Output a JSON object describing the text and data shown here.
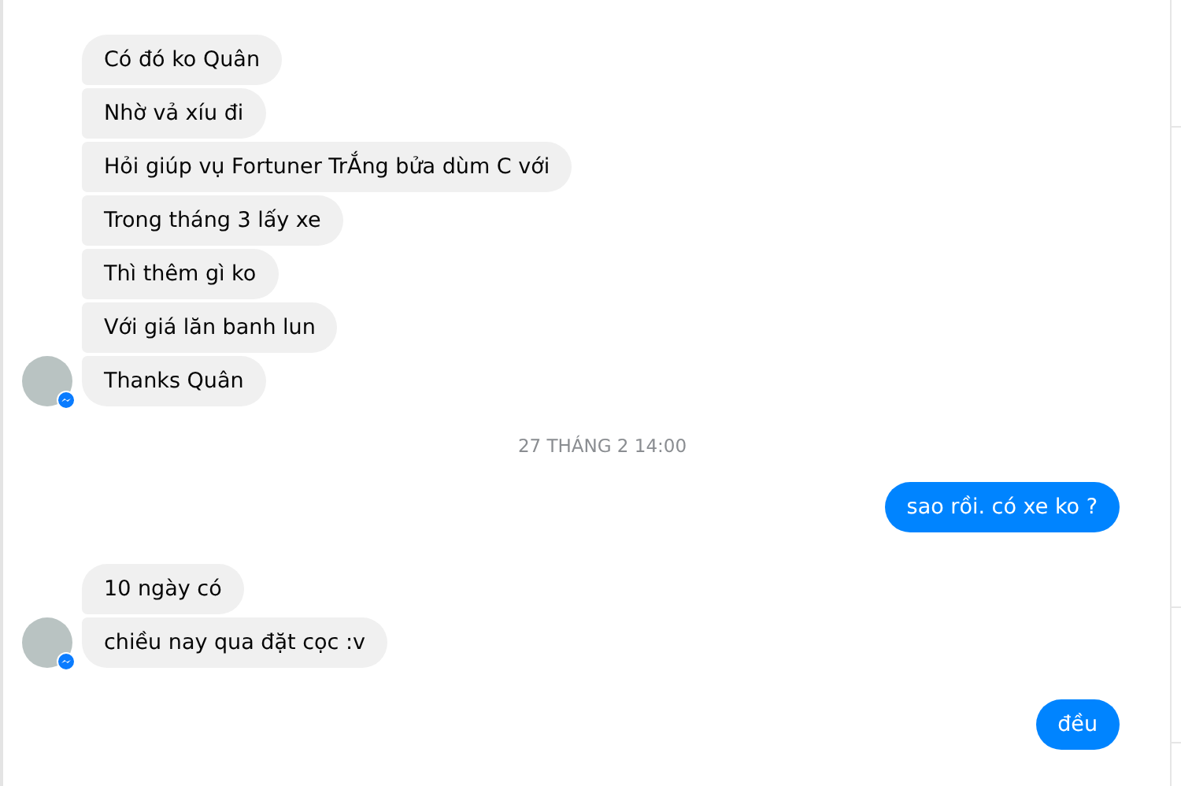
{
  "thread": [
    {
      "kind": "received",
      "messages": [
        "Có đó ko Quân",
        "Nhờ vả xíu đi",
        "Hỏi giúp vụ Fortuner TrẮng bửa dùm C với",
        "Trong tháng 3 lấy xe",
        "Thì thêm gì ko",
        "Với giá lăn banh lun",
        "Thanks Quân"
      ]
    },
    {
      "kind": "timestamp",
      "text": "27 THÁNG 2 14:00"
    },
    {
      "kind": "sent",
      "messages": [
        "sao rồi. có xe ko ?"
      ]
    },
    {
      "kind": "received",
      "messages": [
        "10 ngày có",
        "chiều nay qua đặt cọc :v"
      ]
    },
    {
      "kind": "sent",
      "messages": [
        "đều"
      ]
    }
  ]
}
